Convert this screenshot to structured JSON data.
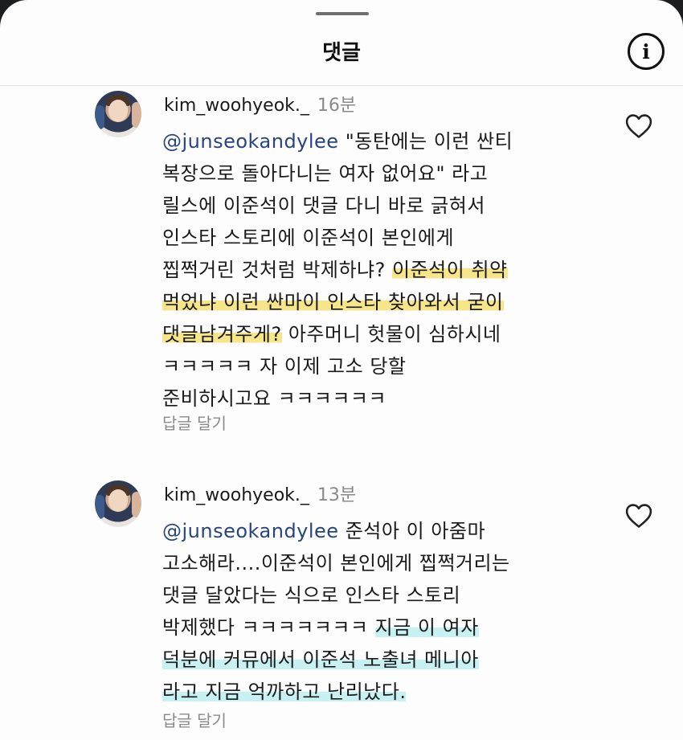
{
  "header": {
    "title": "댓글",
    "info_icon": "info-icon"
  },
  "comments": [
    {
      "username": "kim_woohyeok._",
      "time": "16분",
      "mention": "@junseokandylee",
      "lines": [
        " \"동탄에는 이런 싼티",
        "복장으로 돌아다니는 여자 없어요\" 라고",
        "릴스에 이준석이 댓글 다니 바로 긁혀서",
        "인스타 스토리에 이준석이 본인에게",
        "찝쩍거린 것처럼 박제하냐? ",
        "이준석이 취약",
        "먹었냐 이런 싼마이 인스타 찾아와서 굳이",
        "댓글남겨주게?",
        " 아주머니 헛물이 심하시네",
        "ㅋㅋㅋㅋㅋ 자 이제 고소 당할",
        "준비하시고요 ㅋㅋㅋㅋㅋㅋ"
      ],
      "reply_label": "답글 달기",
      "like_icon": "heart-icon"
    },
    {
      "username": "kim_woohyeok._",
      "time": "13분",
      "mention": "@junseokandylee",
      "lines": [
        " 준석아 이 아줌마",
        "고소해라....이준석이 본인에게 찝쩍거리는",
        "댓글 달았다는 식으로 인스타 스토리",
        "박제했다 ㅋㅋㅋㅋㅋㅋㅋ ",
        "지금 이 여자",
        "덕분에 커뮤에서 이준석 노출녀 메니아",
        "라고 지금 억까하고 난리났다."
      ],
      "reply_label": "답글 달기",
      "like_icon": "heart-icon"
    }
  ]
}
